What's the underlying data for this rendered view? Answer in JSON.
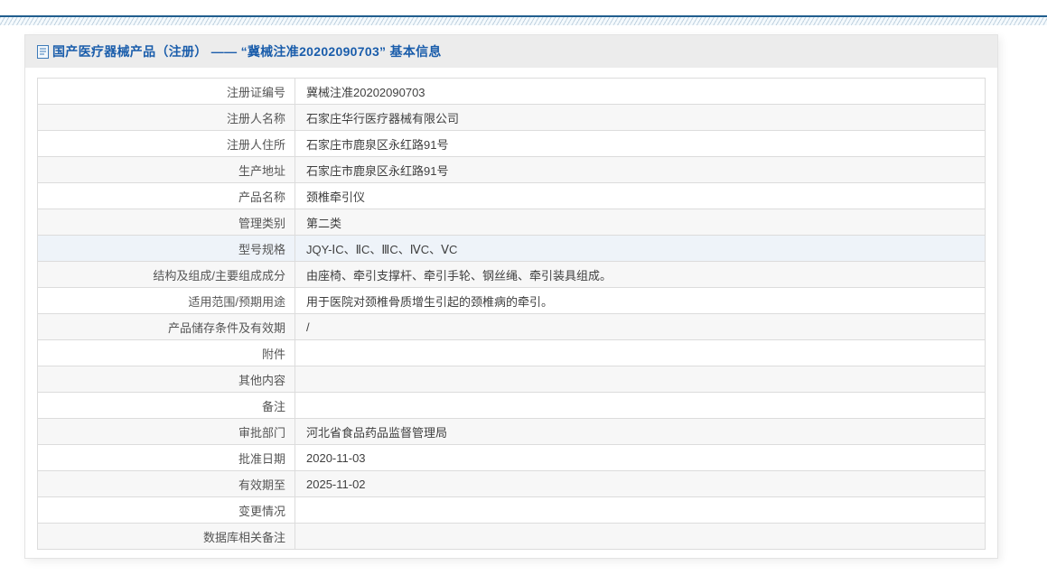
{
  "decor": {
    "top_line_color": "#205e8e",
    "stripe_pattern": "diagonal-light-blue"
  },
  "header": {
    "icon": "document-icon",
    "title": "国产医疗器械产品（注册） —— “冀械注准20202090703” 基本信息",
    "title_color": "#1a5dab"
  },
  "table": {
    "highlighted_row_index": 6,
    "stripe_color": "#f7f7f7",
    "highlight_color": "#eef3f9",
    "rows": [
      {
        "label": "注册证编号",
        "value": "冀械注准20202090703"
      },
      {
        "label": "注册人名称",
        "value": "石家庄华行医疗器械有限公司"
      },
      {
        "label": "注册人住所",
        "value": "石家庄市鹿泉区永红路91号"
      },
      {
        "label": "生产地址",
        "value": "石家庄市鹿泉区永红路91号"
      },
      {
        "label": "产品名称",
        "value": "颈椎牵引仪"
      },
      {
        "label": "管理类别",
        "value": "第二类"
      },
      {
        "label": "型号规格",
        "value": "JQY-ⅠC、ⅡC、ⅢC、ⅣC、ⅤC"
      },
      {
        "label": "结构及组成/主要组成成分",
        "value": "由座椅、牵引支撑杆、牵引手轮、钢丝绳、牵引装具组成。"
      },
      {
        "label": "适用范围/预期用途",
        "value": "用于医院对颈椎骨质增生引起的颈椎病的牵引。"
      },
      {
        "label": "产品储存条件及有效期",
        "value": "/"
      },
      {
        "label": "附件",
        "value": ""
      },
      {
        "label": "其他内容",
        "value": ""
      },
      {
        "label": "备注",
        "value": ""
      },
      {
        "label": "审批部门",
        "value": "河北省食品药品监督管理局"
      },
      {
        "label": "批准日期",
        "value": "2020-11-03"
      },
      {
        "label": "有效期至",
        "value": "2025-11-02"
      },
      {
        "label": "变更情况",
        "value": ""
      },
      {
        "label": "数据库相关备注",
        "value": ""
      }
    ]
  }
}
